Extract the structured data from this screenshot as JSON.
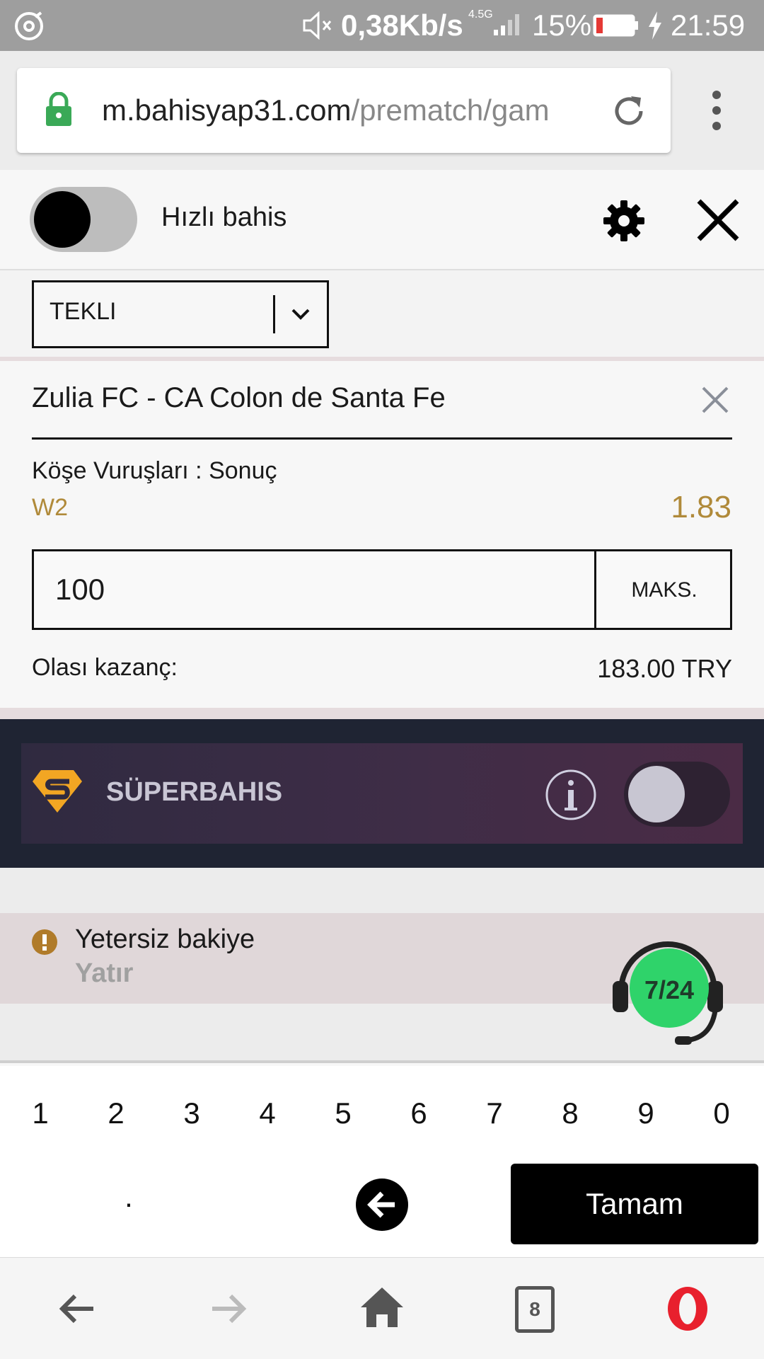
{
  "status_bar": {
    "speed": "0,38Kb/s",
    "network": "4.5G",
    "battery": "15%",
    "time": "21:59"
  },
  "browser": {
    "url_host": "m.bahisyap31.com",
    "url_path": "/prematch/gam"
  },
  "header": {
    "quick_bet_label": "Hızlı bahis"
  },
  "bet_type": {
    "selected": "TEKLI"
  },
  "bet": {
    "match": "Zulia FC - CA Colon de Santa Fe",
    "market": "Köşe Vuruşları : Sonuç",
    "selection": "W2",
    "odds": "1.83",
    "stake": "100",
    "max_label": "MAKS.",
    "potential_label": "Olası kazanç:",
    "potential_value": "183.00 TRY"
  },
  "superbahis": {
    "label": "SÜPERBAHIS"
  },
  "warning": {
    "message": "Yetersiz bakiye",
    "action": "Yatır"
  },
  "support_badge": "7/24",
  "keypad": {
    "digits": [
      "1",
      "2",
      "3",
      "4",
      "5",
      "6",
      "7",
      "8",
      "9",
      "0"
    ],
    "decimal": ".",
    "done_label": "Tamam"
  },
  "bottom_nav": {
    "tab_count": "8"
  },
  "colors": {
    "odds_gold": "#b08a3a",
    "superbahis_bg": "#1f2433",
    "support_green": "#2fd36a",
    "opera_red": "#e8202d"
  }
}
